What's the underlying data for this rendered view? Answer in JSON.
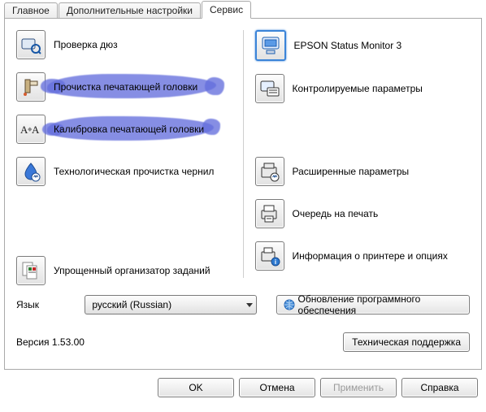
{
  "tabs": {
    "main": "Главное",
    "advanced": "Дополнительные настройки",
    "service": "Сервис"
  },
  "left": {
    "nozzle_check": "Проверка дюз",
    "head_clean": "Прочистка печатающей головки",
    "head_align": "Калибровка печатающей головки",
    "ink_flush": "Технологическая прочистка чернил",
    "job_arranger": "Упрощенный организатор заданий"
  },
  "right": {
    "status_monitor": "EPSON Status Monitor 3",
    "monitored_params": "Контролируемые параметры",
    "extended_settings": "Расширенные параметры",
    "print_queue": "Очередь на печать",
    "printer_info": "Информация о принтере и опциях"
  },
  "language": {
    "label": "Язык",
    "value": "русский (Russian)"
  },
  "update_button": "Обновление программного обеспечения",
  "version": "Версия 1.53.00",
  "tech_support": "Техническая поддержка",
  "buttons": {
    "ok": "OK",
    "cancel": "Отмена",
    "apply": "Применить",
    "help": "Справка"
  }
}
